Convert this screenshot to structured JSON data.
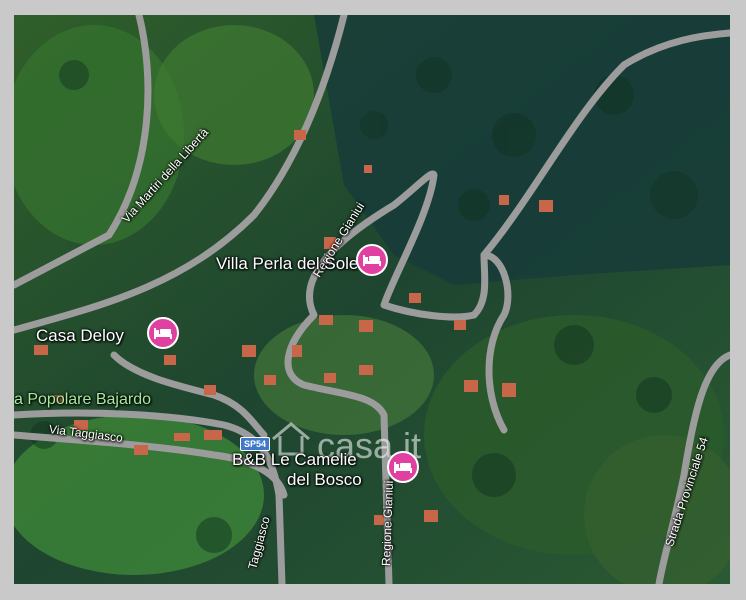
{
  "colors": {
    "forest_dark": "#1f4a2f",
    "forest_light": "#3f7a34",
    "road": "#9a9a9a",
    "pin": "#e040a0",
    "frame": "#c9c9c9",
    "area_label": "#a8e89a"
  },
  "places": [
    {
      "label": "Villa Perla del Sole",
      "icon": "bed-icon"
    },
    {
      "label": "Casa Deloy",
      "icon": "bed-icon"
    },
    {
      "label": "B&B Le Camelie",
      "label2": "del Bosco",
      "icon": "bed-icon"
    }
  ],
  "streets": {
    "via_martiri": "Via Martiri della Libertà",
    "regione_gianiui": "Regione Gianiui",
    "via_taggiasco": "Via Taggiasco",
    "via_taggiasco_2": "Taggiasco",
    "strada_provinciale": "Strada Provinciale 54",
    "gianiui_2": "Regione Gianiui",
    "area": "a Popolare Bajardo"
  },
  "road_shield": "SP54",
  "watermark": "casa.it"
}
